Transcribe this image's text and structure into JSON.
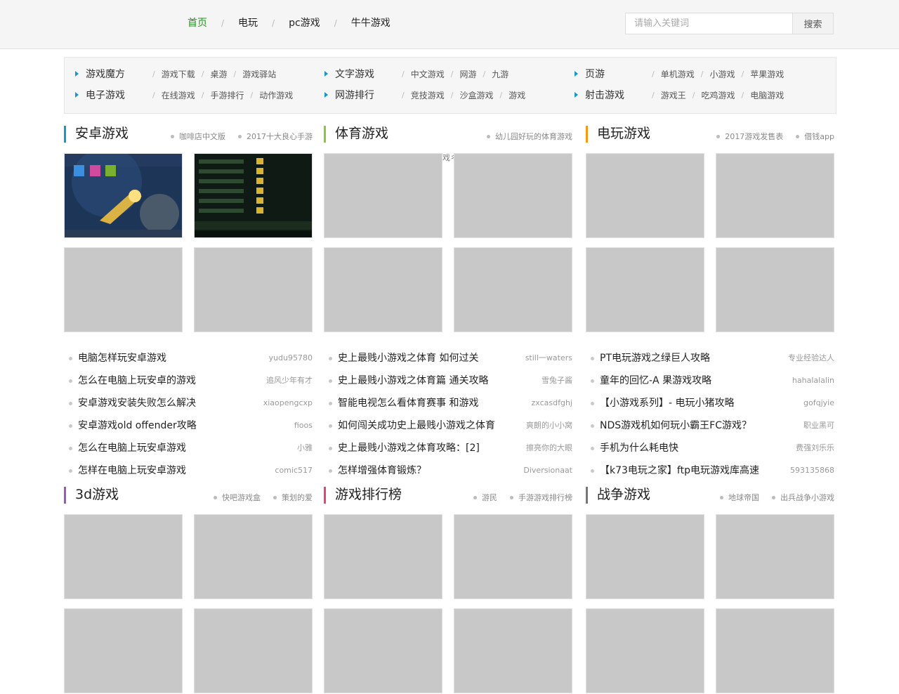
{
  "nav": {
    "items": [
      "首页",
      "电玩",
      "pc游戏",
      "牛牛游戏"
    ],
    "sep": "/"
  },
  "search": {
    "placeholder": "请输入关键词",
    "button": "搜索"
  },
  "categories": {
    "sep": "/",
    "rows": [
      [
        {
          "main": "游戏魔方",
          "subs": [
            "游戏下载",
            "桌游",
            "游戏驿站"
          ]
        },
        {
          "main": "文字游戏",
          "subs": [
            "中文游戏",
            "网游",
            "九游"
          ]
        },
        {
          "main": "页游",
          "subs": [
            "单机游戏",
            "小游戏",
            "苹果游戏"
          ]
        }
      ],
      [
        {
          "main": "电子游戏",
          "subs": [
            "在线游戏",
            "手游排行",
            "动作游戏"
          ]
        },
        {
          "main": "网游排行",
          "subs": [
            "竞技游戏",
            "沙盒游戏",
            "游戏"
          ]
        },
        {
          "main": "射击游戏",
          "subs": [
            "游戏王",
            "吃鸡游戏",
            "电脑游戏"
          ]
        }
      ]
    ]
  },
  "stray_text": "戏ㄔ",
  "sections": [
    {
      "title": "安卓游戏",
      "color": "#1a96c8",
      "tags": [
        "咖啡店中文版",
        "2017十大良心手游"
      ],
      "articles": [
        {
          "title": "电脑怎样玩安卓游戏",
          "author": "yudu95780"
        },
        {
          "title": "怎么在电脑上玩安卓的游戏",
          "author": "追风少年有才"
        },
        {
          "title": "安卓游戏安装失败怎么解决",
          "author": "xiaopengcxp"
        },
        {
          "title": "安卓游戏old offender攻略",
          "author": "fioos"
        },
        {
          "title": "怎么在电脑上玩安卓游戏",
          "author": "小雅"
        },
        {
          "title": "怎样在电脑上玩安卓游戏",
          "author": "comic517"
        }
      ]
    },
    {
      "title": "体育游戏",
      "color": "#8cc63f",
      "tags": [
        "幼儿园好玩的体育游戏"
      ],
      "articles": [
        {
          "title": "史上最贱小游戏之体育 如何过关",
          "author": "still一waters"
        },
        {
          "title": "史上最贱小游戏之体育篇 通关攻略",
          "author": "雪兔子酱"
        },
        {
          "title": "智能电视怎么看体育赛事 和游戏",
          "author": "zxcasdfghj"
        },
        {
          "title": "如何闯关成功史上最贱小游戏之体育",
          "author": "爽朗的小小窝"
        },
        {
          "title": "史上最贱小游戏之体育攻略：[2]",
          "author": "擦亮你的大眼"
        },
        {
          "title": "怎样增强体育锻炼？",
          "author": "Diversionaat"
        }
      ]
    },
    {
      "title": "电玩游戏",
      "color": "#f39c12",
      "tags": [
        "2017游戏发售表",
        "借钱app"
      ],
      "articles": [
        {
          "title": "PT电玩游戏之绿巨人攻略",
          "author": "专业经验达人"
        },
        {
          "title": "童年的回忆-A 果游戏攻略",
          "author": "hahalalalin"
        },
        {
          "title": "【小游戏系列】- 电玩小猪攻略",
          "author": "gofqjyie"
        },
        {
          "title": "NDS游戏机如何玩小霸王FC游戏？",
          "author": "职业黑可"
        },
        {
          "title": "手机为什么耗电快",
          "author": "费强刘乐乐"
        },
        {
          "title": "【k73电玩之家】ftp电玩游戏库高速",
          "author": "593135868"
        }
      ]
    },
    {
      "title": "3d游戏",
      "color": "#9b59b6",
      "tags": [
        "快吧游戏盒",
        "策划的爱"
      ],
      "articles": []
    },
    {
      "title": "游戏排行榜",
      "color": "#e0457b",
      "tags": [
        "游民",
        "手游游戏排行榜"
      ],
      "articles": []
    },
    {
      "title": "战争游戏",
      "color": "#777777",
      "tags": [
        "地球帝国",
        "出兵战争小游戏"
      ],
      "articles": []
    }
  ]
}
